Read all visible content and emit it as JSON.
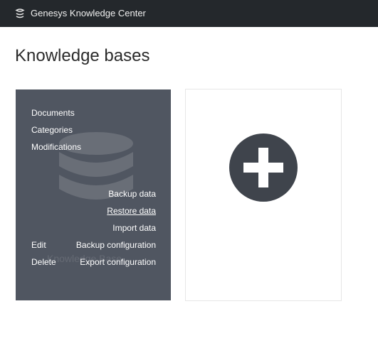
{
  "header": {
    "app_title": "Genesys Knowledge Center",
    "logo_icon": "genesys-logo-icon"
  },
  "page": {
    "title": "Knowledge bases"
  },
  "kb_card": {
    "background_name": "Knowledge Base",
    "links": {
      "documents": "Documents",
      "categories": "Categories",
      "modifications": "Modifications",
      "backup_data": "Backup data",
      "restore_data": "Restore data",
      "import_data": "Import data",
      "edit": "Edit",
      "backup_configuration": "Backup configuration",
      "delete": "Delete",
      "export_configuration": "Export configuration"
    },
    "background_icon": "database-icon"
  },
  "add_card": {
    "icon": "add-plus-icon"
  },
  "colors": {
    "topbar": "#24282c",
    "card": "#505661",
    "plus_circle": "#3f444c"
  }
}
